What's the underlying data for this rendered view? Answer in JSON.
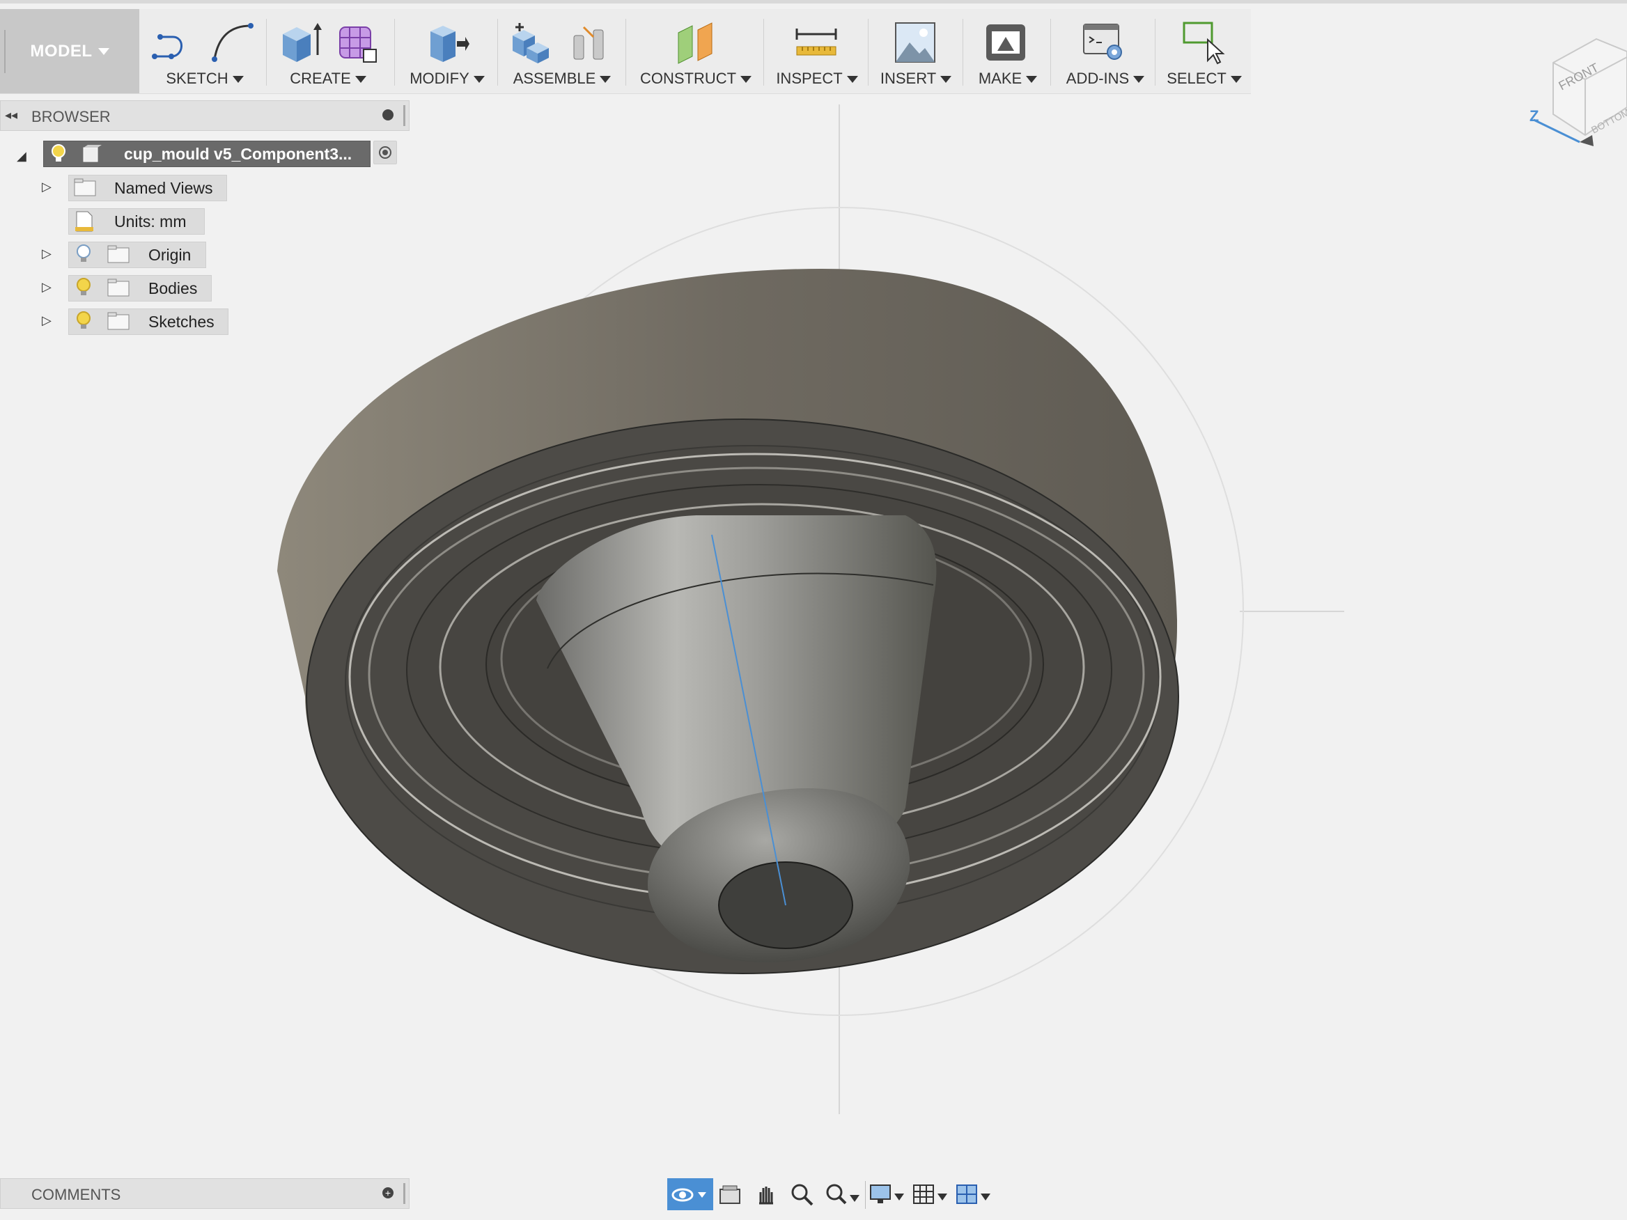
{
  "toolbar": {
    "mode": "MODEL",
    "groups": [
      {
        "label": "SKETCH"
      },
      {
        "label": "CREATE"
      },
      {
        "label": "MODIFY"
      },
      {
        "label": "ASSEMBLE"
      },
      {
        "label": "CONSTRUCT"
      },
      {
        "label": "INSPECT"
      },
      {
        "label": "INSERT"
      },
      {
        "label": "MAKE"
      },
      {
        "label": "ADD-INS"
      },
      {
        "label": "SELECT"
      }
    ]
  },
  "browser": {
    "title": "BROWSER",
    "root": "cup_mould v5_Component3...",
    "items": [
      {
        "label": "Named Views"
      },
      {
        "label": "Units: mm"
      },
      {
        "label": "Origin"
      },
      {
        "label": "Bodies"
      },
      {
        "label": "Sketches"
      }
    ]
  },
  "comments": {
    "title": "COMMENTS"
  },
  "viewcube": {
    "face": "FRONT",
    "axis": "Z",
    "face_bottom": "BOTTOM"
  },
  "colors": {
    "accent": "#4a8fd4",
    "toolbar_bg": "#ececec",
    "model_body": "#6e6a62"
  }
}
